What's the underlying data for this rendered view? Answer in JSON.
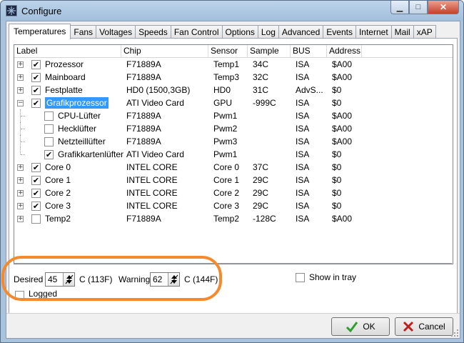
{
  "window": {
    "title": "Configure"
  },
  "tabs": [
    "Temperatures",
    "Fans",
    "Voltages",
    "Speeds",
    "Fan Control",
    "Options",
    "Log",
    "Advanced",
    "Events",
    "Internet",
    "Mail",
    "xAP"
  ],
  "columns": [
    "Label",
    "Chip",
    "Sensor",
    "Sample",
    "BUS",
    "Address"
  ],
  "rows": [
    {
      "label": "Prozessor",
      "chip": "F71889A",
      "sensor": "Temp1",
      "sample": "34C",
      "bus": "ISA",
      "address": "$A00",
      "checked": "✔",
      "expander": "+"
    },
    {
      "label": "Mainboard",
      "chip": "F71889A",
      "sensor": "Temp3",
      "sample": "32C",
      "bus": "ISA",
      "address": "$A00",
      "checked": "✔",
      "expander": "+"
    },
    {
      "label": "Festplatte",
      "chip": "HD0 (1500,3GB)",
      "sensor": "HD0",
      "sample": "31C",
      "bus": "AdvS...",
      "address": "$0",
      "checked": "✔",
      "expander": "+"
    },
    {
      "label": "Grafikprozessor",
      "chip": "ATI Video Card",
      "sensor": "GPU",
      "sample": "-999C",
      "bus": "ISA",
      "address": "$0",
      "checked": "✔",
      "expander": "−"
    },
    {
      "label": "CPU-Lüfter",
      "chip": "F71889A",
      "sensor": "Pwm1",
      "sample": "",
      "bus": "ISA",
      "address": "$A00",
      "checked": ""
    },
    {
      "label": "Hecklüfter",
      "chip": "F71889A",
      "sensor": "Pwm2",
      "sample": "",
      "bus": "ISA",
      "address": "$A00",
      "checked": ""
    },
    {
      "label": "Netzteillüfter",
      "chip": "F71889A",
      "sensor": "Pwm3",
      "sample": "",
      "bus": "ISA",
      "address": "$A00",
      "checked": ""
    },
    {
      "label": "Grafikkartenlüfter",
      "chip": "ATI Video Card",
      "sensor": "Pwm1",
      "sample": "",
      "bus": "ISA",
      "address": "$0",
      "checked": "✔"
    },
    {
      "label": "Core 0",
      "chip": "INTEL CORE",
      "sensor": "Core 0",
      "sample": "37C",
      "bus": "ISA",
      "address": "$0",
      "checked": "✔",
      "expander": "+"
    },
    {
      "label": "Core 1",
      "chip": "INTEL CORE",
      "sensor": "Core 1",
      "sample": "29C",
      "bus": "ISA",
      "address": "$0",
      "checked": "✔",
      "expander": "+"
    },
    {
      "label": "Core 2",
      "chip": "INTEL CORE",
      "sensor": "Core 2",
      "sample": "29C",
      "bus": "ISA",
      "address": "$0",
      "checked": "✔",
      "expander": "+"
    },
    {
      "label": "Core 3",
      "chip": "INTEL CORE",
      "sensor": "Core 3",
      "sample": "29C",
      "bus": "ISA",
      "address": "$0",
      "checked": "✔",
      "expander": "+"
    },
    {
      "label": "Temp2",
      "chip": "F71889A",
      "sensor": "Temp2",
      "sample": "-128C",
      "bus": "ISA",
      "address": "$A00",
      "checked": "",
      "expander": "+"
    }
  ],
  "settings": {
    "desired_label": "Desired",
    "desired_value": "45",
    "desired_unit": "C (113F)",
    "warning_label": "Warning",
    "warning_value": "62",
    "warning_unit": "C (144F)",
    "show_in_tray_label": "Show in tray",
    "logged_label": "Logged"
  },
  "buttons": {
    "ok": "OK",
    "cancel": "Cancel"
  },
  "colors": {
    "selection": "#3399ff",
    "highlight_oval": "#f58a2c",
    "ok_check": "#2e9e2e",
    "cancel_x": "#c0201c"
  }
}
